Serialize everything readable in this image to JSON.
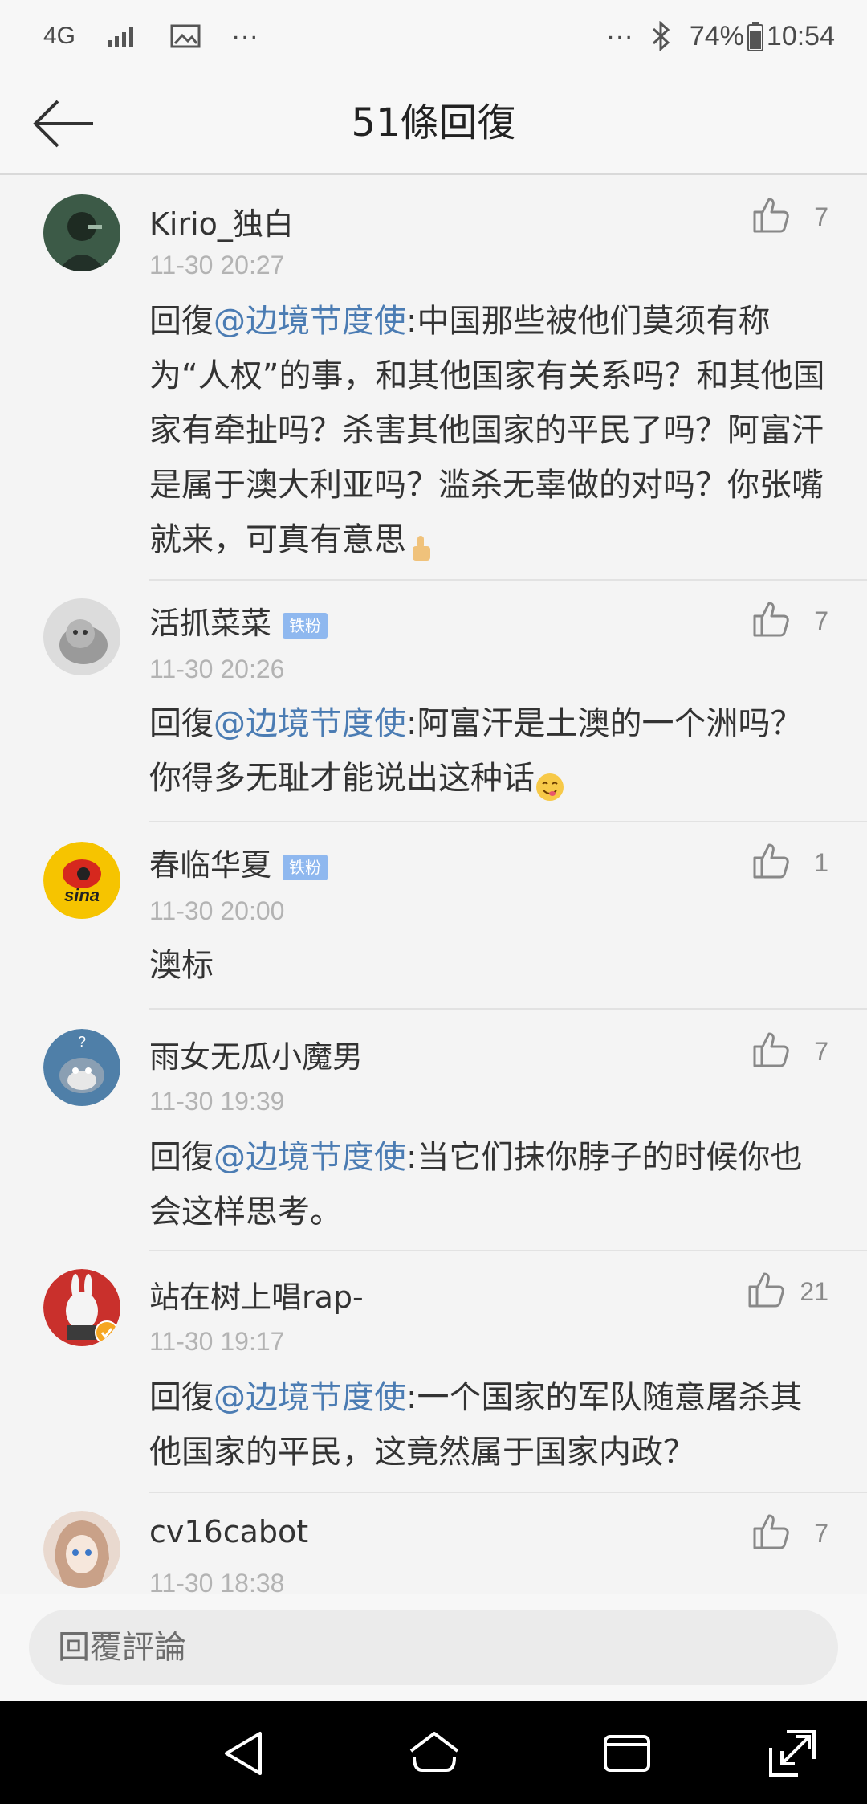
{
  "status_bar": {
    "network": "4G",
    "more": "···",
    "more_right": "···",
    "battery": "74%",
    "time": "10:54"
  },
  "header": {
    "title": "51條回復"
  },
  "comments": [
    {
      "username": "Kirio_独白",
      "badge": "",
      "timestamp": "11-30 20:27",
      "prefix": "回復",
      "mention": "@边境节度使",
      "text": ":中国那些被他们莫须有称为“人权”的事，和其他国家有关系吗？和其他国家有牵扯吗？杀害其他国家的平民了吗？阿富汗是属于澳大利亚吗？滥杀无辜做的对吗？你张嘴就来，可真有意思",
      "emoji": "thumbs-up-emoji",
      "likes": "7"
    },
    {
      "username": "活抓菜菜",
      "badge": "铁粉",
      "timestamp": "11-30 20:26",
      "prefix": "回復",
      "mention": "@边境节度使",
      "text": ":阿富汗是土澳的一个洲吗？你得多无耻才能说出这种话",
      "emoji": "yum-face-emoji",
      "likes": "7"
    },
    {
      "username": "春临华夏",
      "badge": "铁粉",
      "timestamp": "11-30 20:00",
      "prefix": "",
      "mention": "",
      "text": "澳标",
      "emoji": "",
      "likes": "1"
    },
    {
      "username": "雨女无瓜小魔男",
      "badge": "",
      "timestamp": "11-30 19:39",
      "prefix": "回復",
      "mention": "@边境节度使",
      "text": ":当它们抹你脖子的时候你也会这样思考。",
      "emoji": "",
      "likes": "7"
    },
    {
      "username": "站在树上唱rap-",
      "badge": "",
      "timestamp": "11-30 19:17",
      "prefix": "回復",
      "mention": "@边境节度使",
      "text": ":一个国家的军队随意屠杀其他国家的平民，这竟然属于国家内政？",
      "emoji": "",
      "likes": "21"
    },
    {
      "username": "cv16cabot",
      "badge": "",
      "timestamp": "11-30 18:38",
      "prefix": "",
      "mention": "",
      "text": "",
      "emoji": "",
      "likes": "7"
    }
  ],
  "reply_bar": {
    "placeholder": "回覆評論"
  },
  "colors": {
    "mention": "#4b7cb3",
    "badge": "#8fb8ef",
    "timestamp": "#b3b3b3",
    "background": "#f4f4f4"
  }
}
